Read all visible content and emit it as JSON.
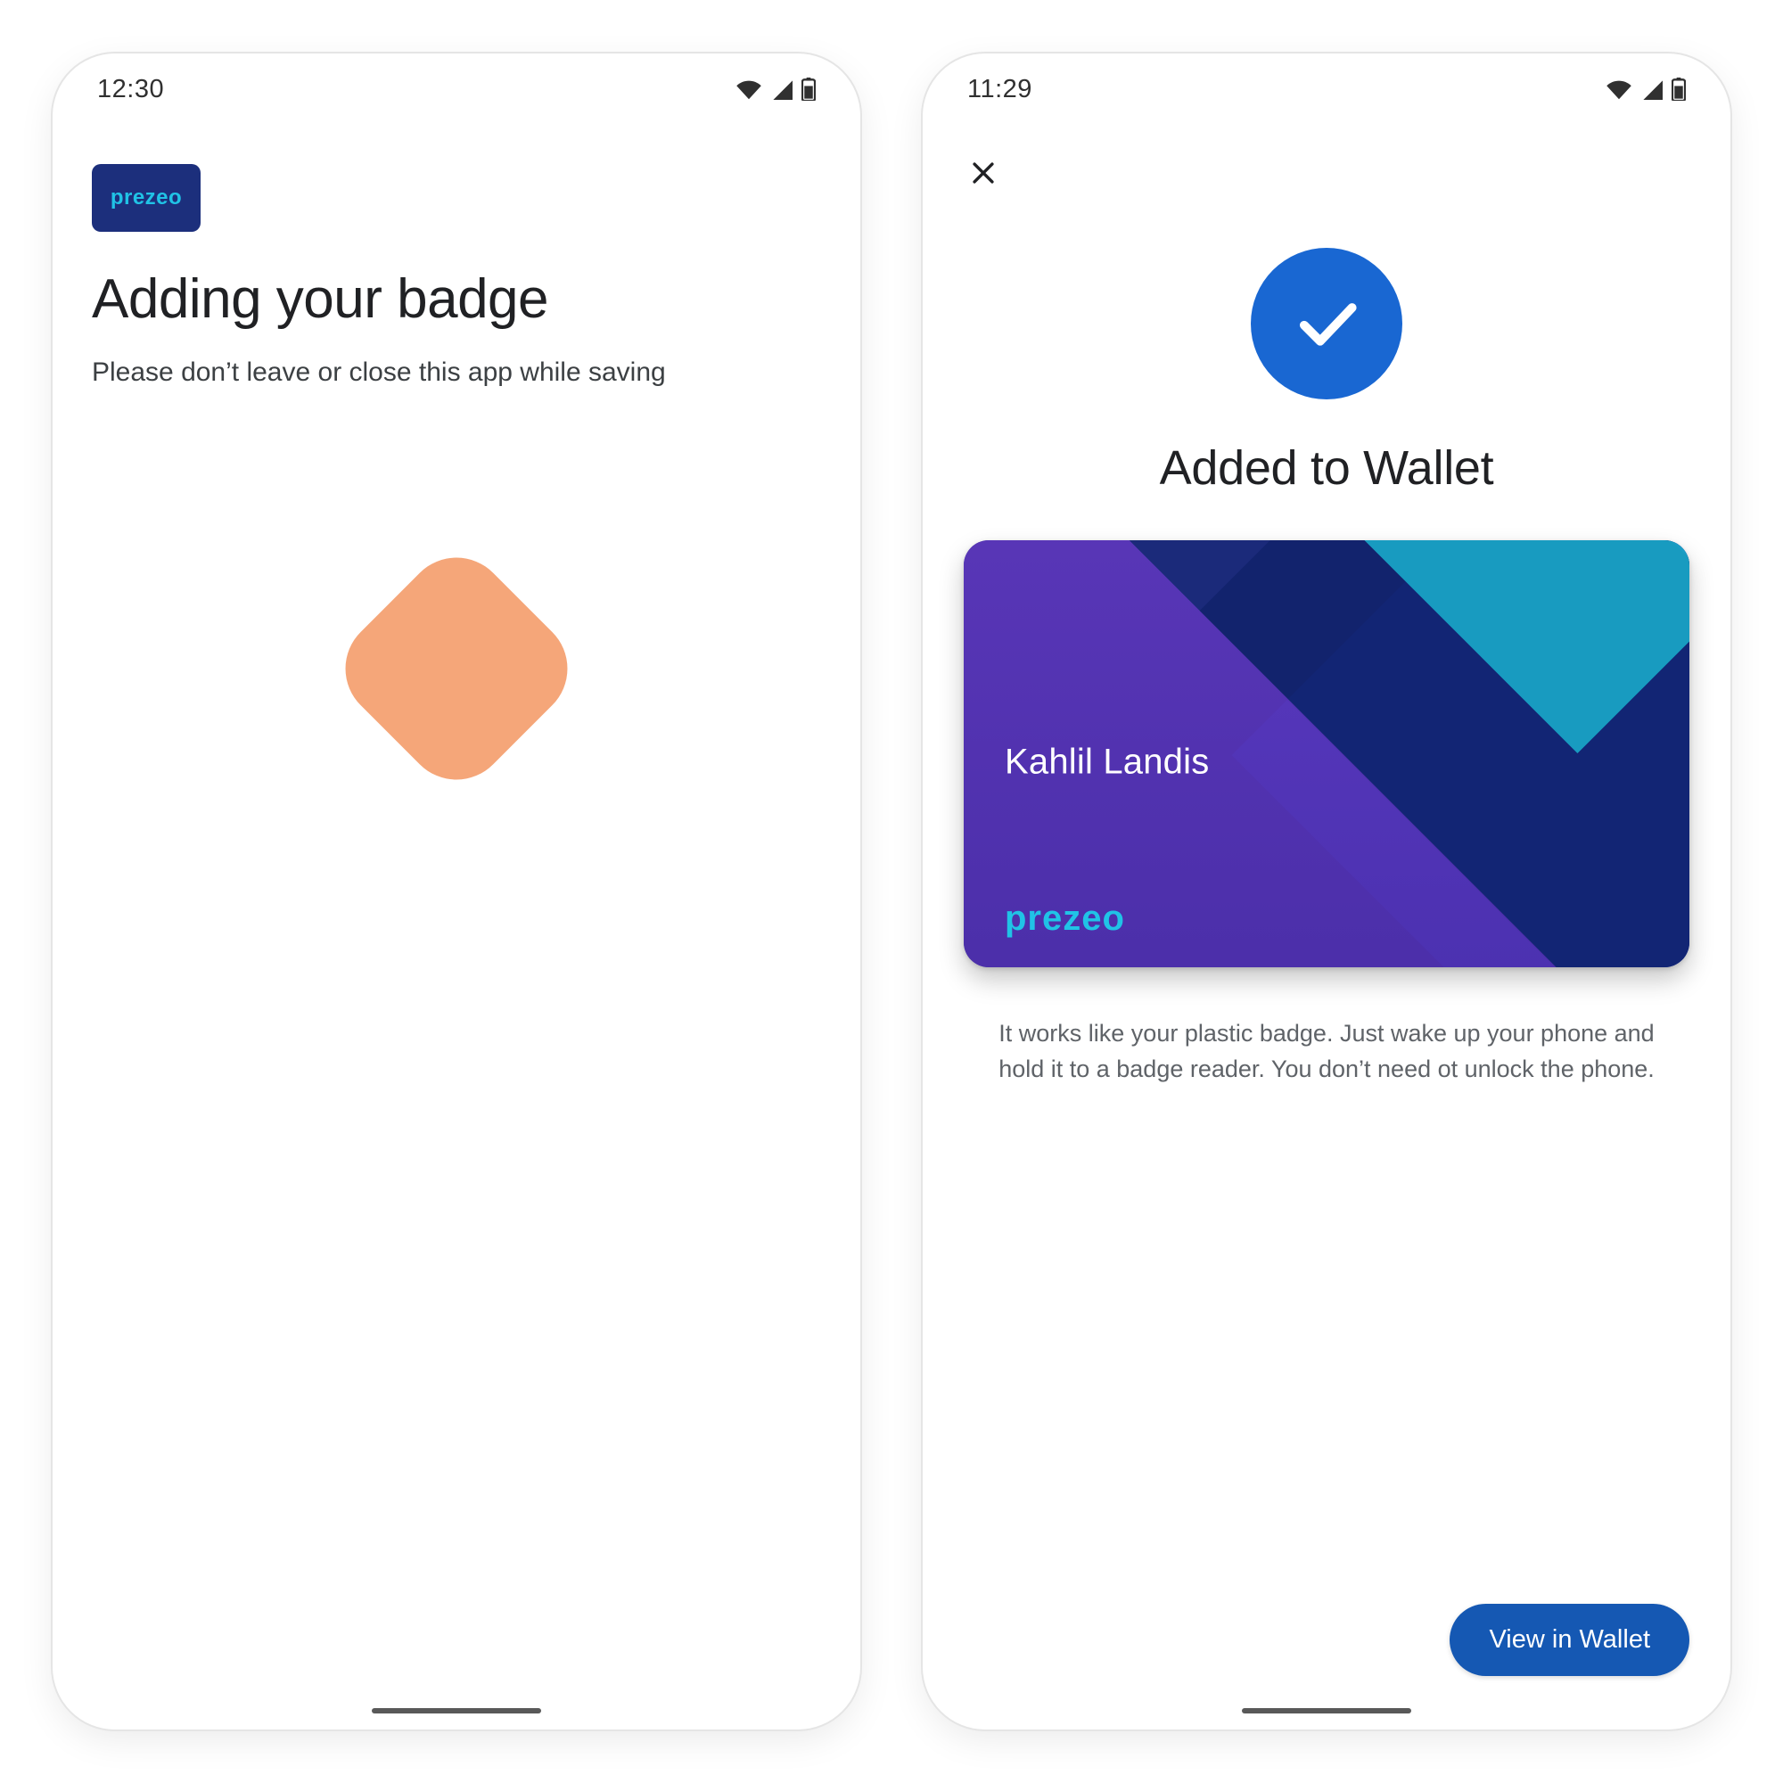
{
  "colors": {
    "accent": "#1a73e8",
    "prezeo_bg": "#1c2f7c",
    "prezeo_text": "#20c3e6",
    "spinner": "#f5a679",
    "check_circle": "#1967d2"
  },
  "screen1": {
    "status": {
      "time": "12:30"
    },
    "brand": "prezeo",
    "title": "Adding your badge",
    "subtitle": "Please don’t leave or close this app while saving"
  },
  "screen2": {
    "status": {
      "time": "11:29"
    },
    "title": "Added to Wallet",
    "card": {
      "holder_name": "Kahlil Landis",
      "brand": "prezeo"
    },
    "description": "It works like your plastic badge. Just wake up your phone and hold it to a badge reader. You don’t need ot unlock the phone.",
    "cta": "View in Wallet"
  }
}
